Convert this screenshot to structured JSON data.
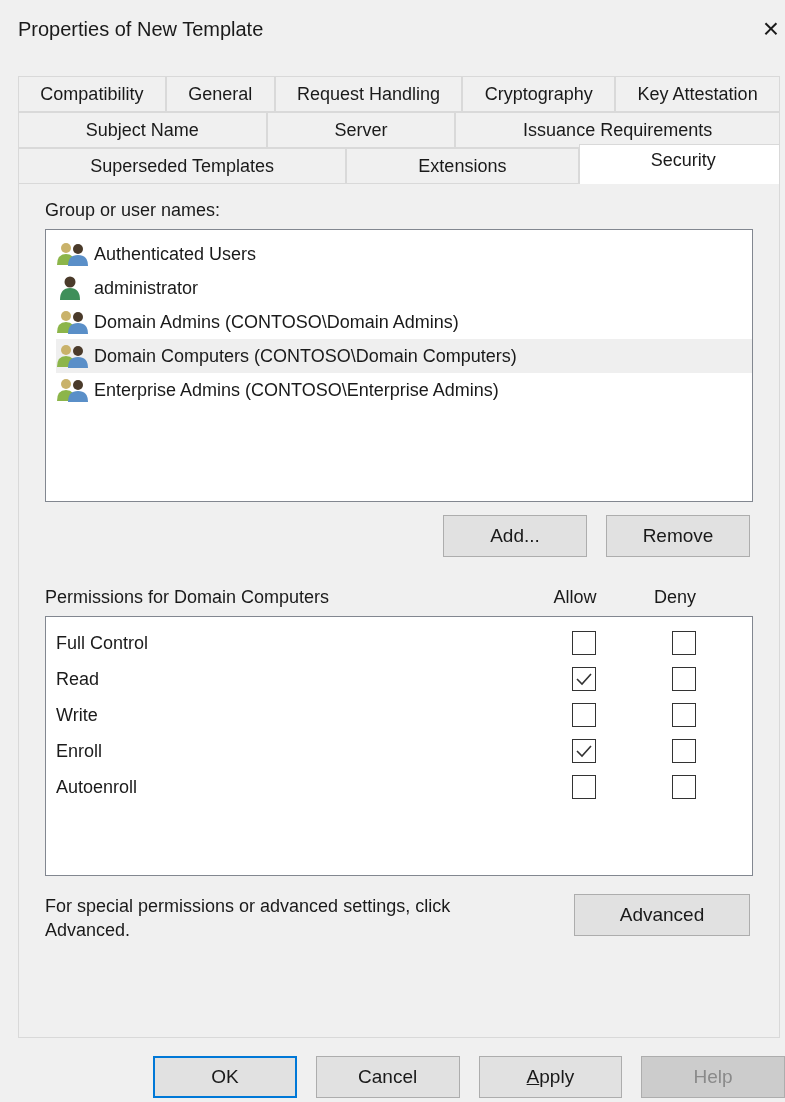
{
  "window": {
    "title": "Properties of New Template",
    "close": "×"
  },
  "tab_rows": [
    [
      {
        "label": "Compatibility",
        "selected": false
      },
      {
        "label": "General",
        "selected": false
      },
      {
        "label": "Request Handling",
        "selected": false
      },
      {
        "label": "Cryptography",
        "selected": false
      },
      {
        "label": "Key Attestation",
        "selected": false
      }
    ],
    [
      {
        "label": "Subject Name",
        "selected": false
      },
      {
        "label": "Server",
        "selected": false
      },
      {
        "label": "Issuance Requirements",
        "selected": false
      }
    ],
    [
      {
        "label": "Superseded Templates",
        "selected": false
      },
      {
        "label": "Extensions",
        "selected": false
      },
      {
        "label": "Security",
        "selected": true
      }
    ]
  ],
  "principals": {
    "label": "Group or user names:",
    "items": [
      {
        "name": "Authenticated Users",
        "kind": "group",
        "selected": false
      },
      {
        "name": "administrator",
        "kind": "user",
        "selected": false
      },
      {
        "name": "Domain Admins (CONTOSO\\Domain Admins)",
        "kind": "group",
        "selected": false
      },
      {
        "name": "Domain Computers (CONTOSO\\Domain Computers)",
        "kind": "group",
        "selected": true
      },
      {
        "name": "Enterprise Admins (CONTOSO\\Enterprise Admins)",
        "kind": "group",
        "selected": false
      }
    ]
  },
  "principal_buttons": [
    "Add...",
    "Remove"
  ],
  "permissions": {
    "label": "Permissions for Domain Computers",
    "allow_header": "Allow",
    "deny_header": "Deny",
    "rows": [
      {
        "name": "Full Control",
        "allow": false,
        "deny": false
      },
      {
        "name": "Read",
        "allow": true,
        "deny": false
      },
      {
        "name": "Write",
        "allow": false,
        "deny": false
      },
      {
        "name": "Enroll",
        "allow": true,
        "deny": false
      },
      {
        "name": "Autoenroll",
        "allow": false,
        "deny": false
      }
    ]
  },
  "advanced": {
    "text": "For special permissions or advanced settings, click Advanced.",
    "button": "Advanced"
  },
  "footer_buttons": [
    {
      "label": "OK",
      "default": true,
      "disabled": false
    },
    {
      "label": "Cancel",
      "default": false,
      "disabled": false
    },
    {
      "access_key": "A",
      "label": "pply",
      "default": false,
      "disabled": false
    },
    {
      "label": "Help",
      "default": false,
      "disabled": true
    }
  ]
}
